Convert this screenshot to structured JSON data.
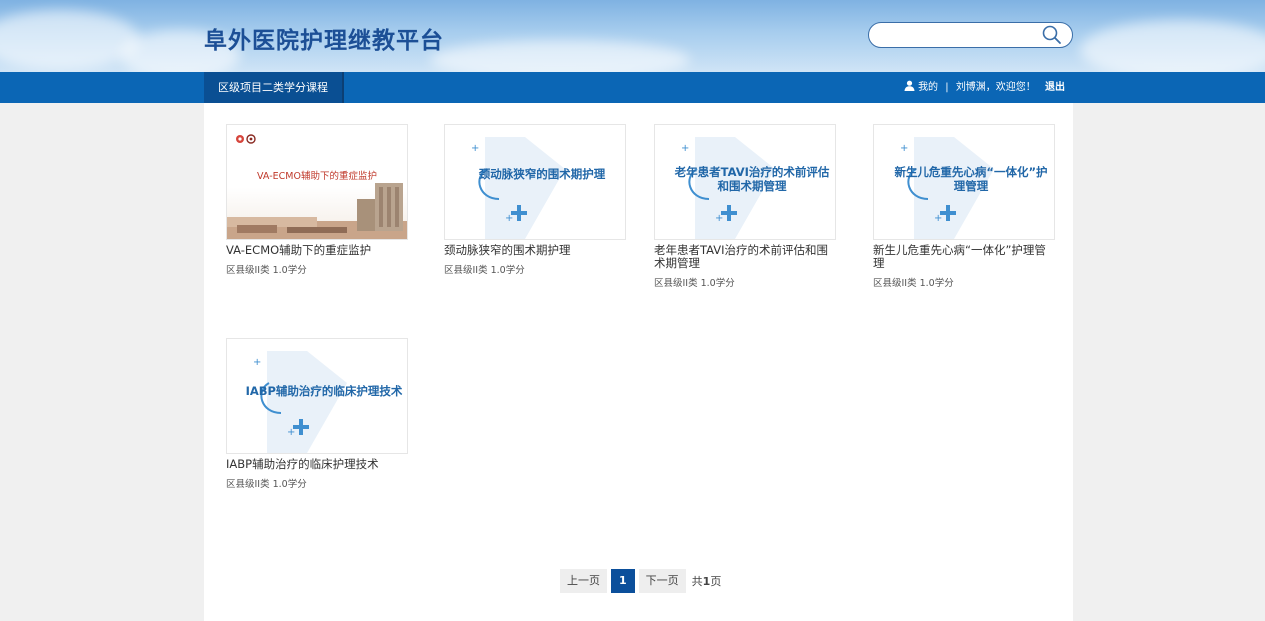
{
  "header": {
    "site_title": "阜外医院护理继教平台",
    "search_placeholder": ""
  },
  "nav": {
    "tab_label": "区级项目二类学分课程",
    "my_label": "我的",
    "separator": "|",
    "welcome": "刘博渊，欢迎您！",
    "logout": "退出"
  },
  "courses": [
    {
      "thumb_title": "VA-ECMO辅助下的重症监护",
      "title": "VA-ECMO辅助下的重症监护",
      "credit": "区县级II类 1.0学分"
    },
    {
      "thumb_title": "颈动脉狭窄的围术期护理",
      "title": "颈动脉狭窄的围术期护理",
      "credit": "区县级II类 1.0学分"
    },
    {
      "thumb_title": "老年患者TAVI治疗的术前评估和围术期管理",
      "title": "老年患者TAVI治疗的术前评估和围术期管理",
      "credit": "区县级II类 1.0学分"
    },
    {
      "thumb_title": "新生儿危重先心病“一体化”护理管理",
      "title": "新生儿危重先心病“一体化”护理管理",
      "credit": "区县级II类 1.0学分"
    },
    {
      "thumb_title": "IABP辅助治疗的临床护理技术",
      "title": "IABP辅助治疗的临床护理技术",
      "credit": "区县级II类 1.0学分"
    }
  ],
  "pager": {
    "prev": "上一页",
    "current": "1",
    "next": "下一页",
    "total_prefix": "共",
    "total_pages": "1",
    "total_suffix": "页"
  },
  "colors": {
    "nav_bg": "#0b66b5",
    "nav_tab_bg": "#0a4f93",
    "title_blue": "#1c4f96",
    "thumb_blue": "#2167a8",
    "pager_active": "#0b4f9b"
  }
}
